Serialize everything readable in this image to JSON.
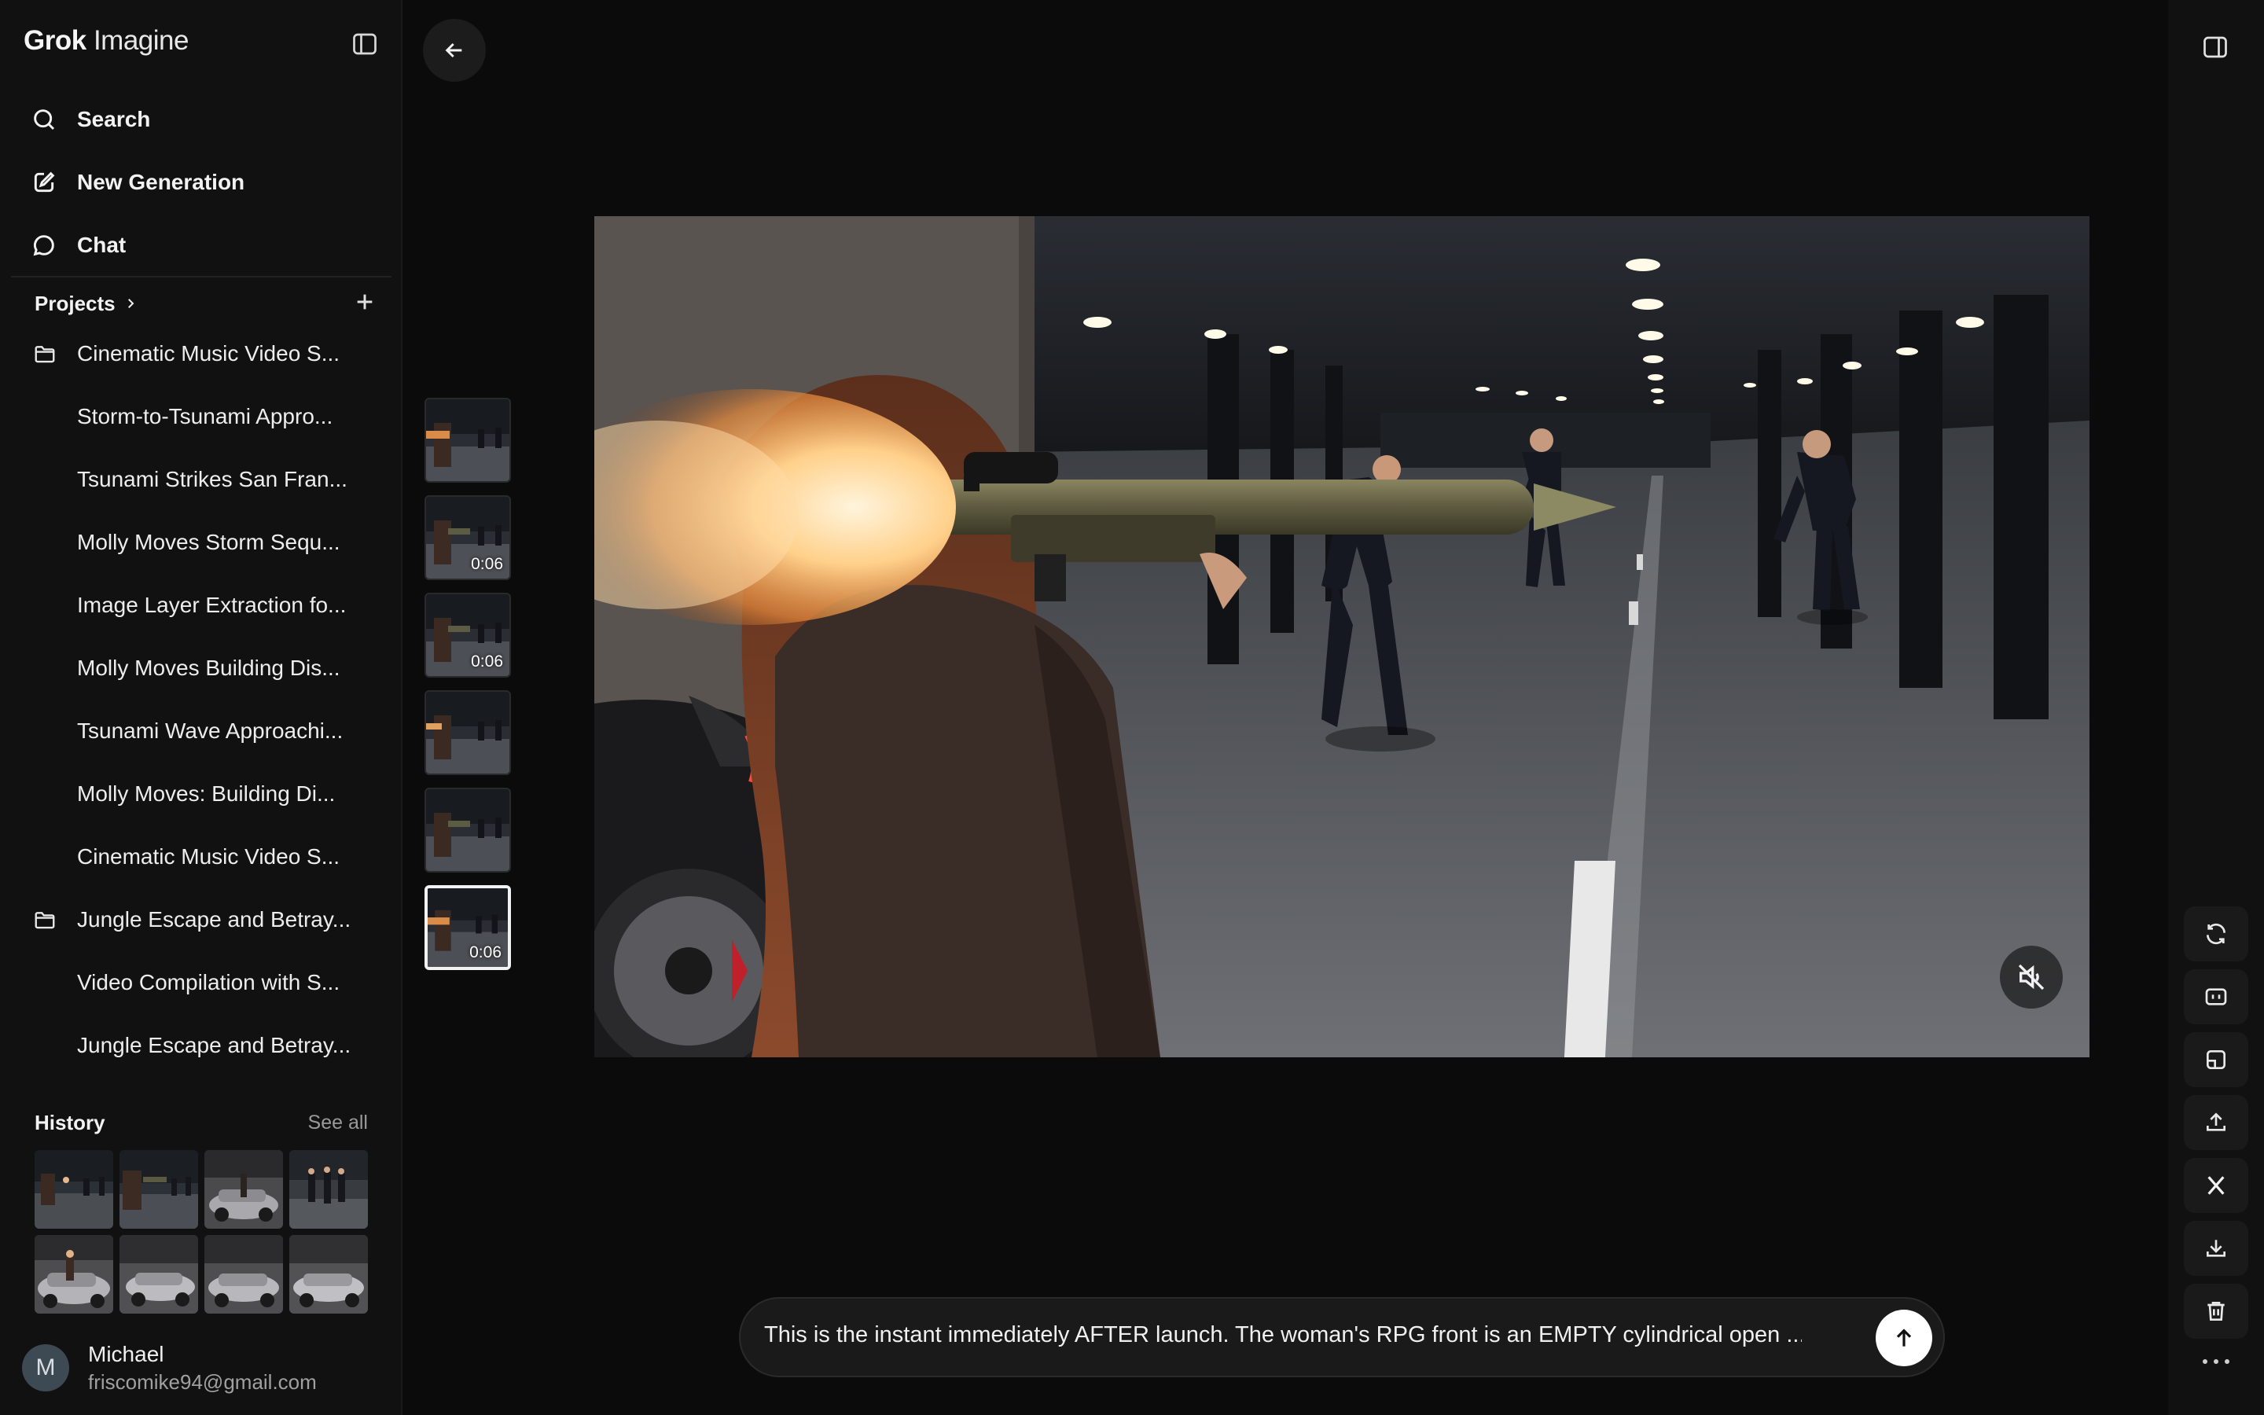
{
  "app": {
    "brand_bold": "Grok",
    "brand_light": "Imagine"
  },
  "sidebar": {
    "nav": [
      {
        "label": "Search",
        "icon": "search-icon"
      },
      {
        "label": "New Generation",
        "icon": "edit-icon"
      },
      {
        "label": "Chat",
        "icon": "chat-bubble-icon"
      }
    ],
    "projects_label": "Projects",
    "projects": [
      {
        "label": "Cinematic Music Video S...",
        "folder": true
      },
      {
        "label": "Storm-to-Tsunami Appro...",
        "folder": false
      },
      {
        "label": "Tsunami Strikes San Fran...",
        "folder": false
      },
      {
        "label": "Molly Moves Storm Sequ...",
        "folder": false
      },
      {
        "label": "Image Layer Extraction fo...",
        "folder": false
      },
      {
        "label": "Molly Moves Building Dis...",
        "folder": false
      },
      {
        "label": "Tsunami Wave Approachi...",
        "folder": false
      },
      {
        "label": "Molly Moves: Building Di...",
        "folder": false
      },
      {
        "label": "Cinematic Music Video S...",
        "folder": false
      },
      {
        "label": "Jungle Escape and Betray...",
        "folder": true
      },
      {
        "label": "Video Compilation with S...",
        "folder": false
      },
      {
        "label": "Jungle Escape and Betray...",
        "folder": false
      }
    ],
    "history_label": "History",
    "see_all_label": "See all",
    "user": {
      "initial": "M",
      "name": "Michael",
      "email": "friscomike94@gmail.com"
    }
  },
  "main": {
    "thumbnails": [
      {
        "duration": ""
      },
      {
        "duration": "0:06"
      },
      {
        "duration": "0:06"
      },
      {
        "duration": ""
      },
      {
        "duration": ""
      },
      {
        "duration": "0:06",
        "selected": true
      }
    ],
    "prompt_text": "This is the instant immediately AFTER launch. The woman's RPG front is an EMPTY cylindrical open ..."
  },
  "rail": {
    "buttons": [
      "refresh-icon",
      "video-icon",
      "layout-icon",
      "upload-icon",
      "x-logo-icon",
      "download-icon",
      "trash-icon"
    ]
  },
  "colors": {
    "background": "#0b0b0b",
    "sidebar": "#111111",
    "button": "#1a1a1a",
    "accent": "#ffffff"
  }
}
